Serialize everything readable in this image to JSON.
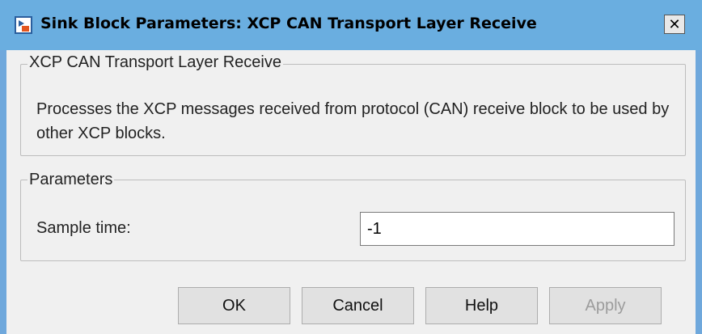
{
  "window": {
    "title": "Sink Block Parameters: XCP CAN Transport Layer Receive",
    "close_glyph": "✕",
    "icon": "simulink-block-icon"
  },
  "description_group": {
    "legend": "XCP CAN Transport Layer Receive",
    "text": "Processes the XCP messages received from protocol (CAN) receive block to be used by other XCP blocks."
  },
  "parameters_group": {
    "legend": "Parameters",
    "sample_time_label": "Sample time:",
    "sample_time_value": "-1"
  },
  "buttons": {
    "ok": "OK",
    "cancel": "Cancel",
    "help": "Help",
    "apply": "Apply"
  }
}
